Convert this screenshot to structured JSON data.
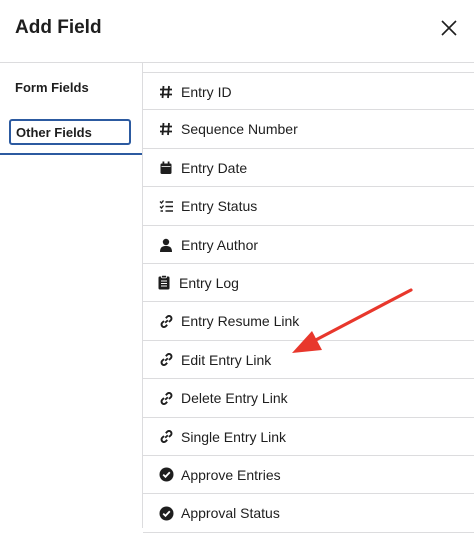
{
  "header": {
    "title": "Add Field",
    "close_icon": "close-icon"
  },
  "tabs": [
    {
      "label": "Form Fields",
      "active": false
    },
    {
      "label": "Other Fields",
      "active": true
    }
  ],
  "fields": [
    {
      "label": "Entry ID",
      "icon": "hash-icon"
    },
    {
      "label": "Sequence Number",
      "icon": "hash-icon"
    },
    {
      "label": "Entry Date",
      "icon": "calendar-icon"
    },
    {
      "label": "Entry Status",
      "icon": "checklist-icon"
    },
    {
      "label": "Entry Author",
      "icon": "user-icon"
    },
    {
      "label": "Entry Log",
      "icon": "clipboard-icon"
    },
    {
      "label": "Entry Resume Link",
      "icon": "link-icon"
    },
    {
      "label": "Edit Entry Link",
      "icon": "link-icon"
    },
    {
      "label": "Delete Entry Link",
      "icon": "link-icon"
    },
    {
      "label": "Single Entry Link",
      "icon": "link-icon"
    },
    {
      "label": "Approve Entries",
      "icon": "check-circle-icon"
    },
    {
      "label": "Approval Status",
      "icon": "check-circle-icon"
    }
  ],
  "annotation": {
    "color": "#e8372c",
    "points_to": "Edit Entry Link"
  }
}
